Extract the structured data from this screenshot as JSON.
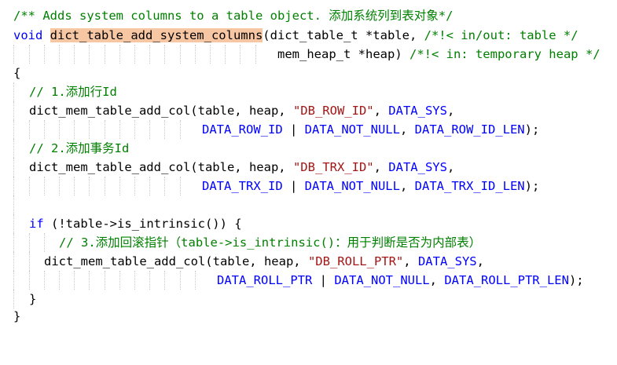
{
  "code": {
    "l1_comment": "/** Adds system columns to a table object. 添加系统列到表对象*/",
    "l2_kw": "void",
    "l2_fn": "dict_table_add_system_columns",
    "l2_open": "(",
    "l2_type": "dict_table_t",
    "l2_rest": " *table, ",
    "l2_comment": "/*!< in/out: table */",
    "l3_type": "mem_heap_t",
    "l3_rest": " *heap) ",
    "l3_comment": "/*!< in: temporary heap */",
    "l4_brace": "{",
    "l5_comment": "// 1.添加行Id",
    "l6_call": "dict_mem_table_add_col(table, heap, ",
    "l6_str": "\"DB_ROW_ID\"",
    "l6_sep": ", ",
    "l6_const": "DATA_SYS",
    "l6_end": ",",
    "l7_c1": "DATA_ROW_ID",
    "l7_p1": " | ",
    "l7_c2": "DATA_NOT_NULL",
    "l7_p2": ", ",
    "l7_c3": "DATA_ROW_ID_LEN",
    "l7_end": ");",
    "l8_comment": "// 2.添加事务Id",
    "l9_call": "dict_mem_table_add_col(table, heap, ",
    "l9_str": "\"DB_TRX_ID\"",
    "l9_sep": ", ",
    "l9_const": "DATA_SYS",
    "l9_end": ",",
    "l10_c1": "DATA_TRX_ID",
    "l10_p1": " | ",
    "l10_c2": "DATA_NOT_NULL",
    "l10_p2": ", ",
    "l10_c3": "DATA_TRX_ID_LEN",
    "l10_end": ");",
    "l12_kw": "if",
    "l12_rest": " (!table->is_intrinsic()) {",
    "l13_comment": "// 3.添加回滚指针（table->is_intrinsic()：用于判断是否为内部表）",
    "l14_call": "dict_mem_table_add_col(table, heap, ",
    "l14_str": "\"DB_ROLL_PTR\"",
    "l14_sep": ", ",
    "l14_const": "DATA_SYS",
    "l14_end": ",",
    "l15_c1": "DATA_ROLL_PTR",
    "l15_p1": " | ",
    "l15_c2": "DATA_NOT_NULL",
    "l15_p2": ", ",
    "l15_c3": "DATA_ROLL_PTR_LEN",
    "l15_end": ");",
    "l16_brace": "}",
    "l17_brace": "}"
  },
  "colors": {
    "keyword": "#0000ff",
    "comment": "#008000",
    "string": "#a31515",
    "highlight": "#f7c6a3"
  }
}
